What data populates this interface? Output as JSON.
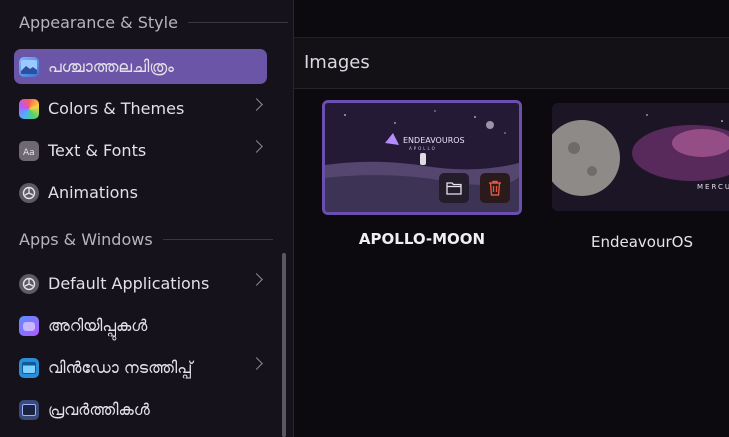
{
  "sidebar": {
    "section_appearance": "Appearance & Style",
    "section_apps": "Apps & Windows",
    "items": [
      {
        "label": "പശ്ചാത്തലചിത്രം",
        "icon": "wallpaper-icon",
        "active": true,
        "has_chevron": false
      },
      {
        "label": "Colors & Themes",
        "icon": "color-palette-icon",
        "active": false,
        "has_chevron": true
      },
      {
        "label": "Text & Fonts",
        "icon": "font-icon",
        "active": false,
        "has_chevron": true
      },
      {
        "label": "Animations",
        "icon": "animation-icon",
        "active": false,
        "has_chevron": false
      },
      {
        "label": "Default Applications",
        "icon": "default-apps-icon",
        "active": false,
        "has_chevron": true
      },
      {
        "label": "അറിയിപ്പുകൾ",
        "icon": "notifications-icon",
        "active": false,
        "has_chevron": false
      },
      {
        "label": "വിൻഡോ നടത്തിപ്പ്",
        "icon": "window-management-icon",
        "active": false,
        "has_chevron": true
      },
      {
        "label": "പ്രവർത്തികൾ",
        "icon": "activities-icon",
        "active": false,
        "has_chevron": false
      }
    ]
  },
  "main": {
    "images_title": "Images",
    "wallpapers": [
      {
        "label": "APOLLO-MOON",
        "selected": true,
        "logo_text": "ENDEAVOUROS",
        "logo_sub": "APOLLO"
      },
      {
        "label": "EndeavourOS",
        "selected": false,
        "overlay_text": "MERCUR"
      }
    ]
  },
  "colors": {
    "accent": "#6b55a6",
    "selection_border": "#6a4fb0",
    "delete_icon": "#e0573f"
  }
}
